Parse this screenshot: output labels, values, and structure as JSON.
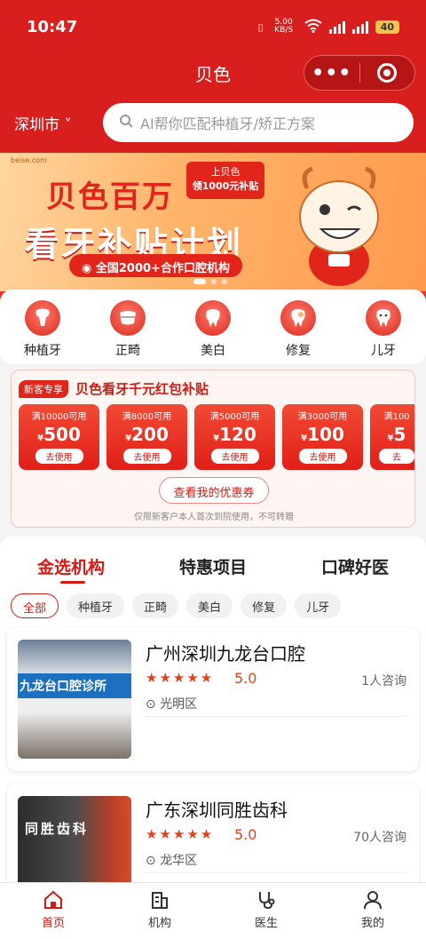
{
  "status": {
    "time": "10:47",
    "speed": "5.00 KB/S",
    "battery": "40"
  },
  "app": {
    "title": "贝色",
    "capsule_more": "•••"
  },
  "search": {
    "city": "深圳市 ˅",
    "placeholder": "AI帮你匹配种植牙/矫正方案"
  },
  "banner": {
    "site": "beise.com",
    "headline": "贝色百万",
    "subheadline": "看牙补贴计划",
    "tag_line1": "上贝色",
    "tag_line2": "领1000元补贴",
    "pill": "全国2000+合作口腔机构"
  },
  "categories": [
    {
      "label": "种植牙",
      "icon": "implant-tooth-icon"
    },
    {
      "label": "正畸",
      "icon": "braces-tooth-icon"
    },
    {
      "label": "美白",
      "icon": "whitening-tooth-icon"
    },
    {
      "label": "修复",
      "icon": "repair-tooth-icon"
    },
    {
      "label": "儿牙",
      "icon": "kids-tooth-icon"
    }
  ],
  "coupon_panel": {
    "tag": "新客专享",
    "title": "贝色看牙千元红包补贴",
    "coupons": [
      {
        "condition": "满10000可用",
        "amount": "500",
        "action": "去使用"
      },
      {
        "condition": "满8000可用",
        "amount": "200",
        "action": "去使用"
      },
      {
        "condition": "满5000可用",
        "amount": "120",
        "action": "去使用"
      },
      {
        "condition": "满3000可用",
        "amount": "100",
        "action": "去使用"
      },
      {
        "condition": "满100",
        "amount": "5",
        "action": "去"
      }
    ],
    "currency": "¥",
    "view_button": "查看我的优惠券",
    "note": "仅限新客户本人首次到院使用，不可转赠"
  },
  "tabs": [
    "金选机构",
    "特惠项目",
    "口碑好医"
  ],
  "chips": [
    "全部",
    "种植牙",
    "正畸",
    "美白",
    "修复",
    "儿牙"
  ],
  "clinics": [
    {
      "name": "广州深圳九龙台口腔",
      "stars": "★★★★★",
      "score": "5.0",
      "consult": "1人咨询",
      "area": "光明区",
      "sign": "九龙台口腔诊所"
    },
    {
      "name": "广东深圳同胜齿科",
      "stars": "★★★★★",
      "score": "5.0",
      "consult": "70人咨询",
      "area": "龙华区",
      "sign": "同胜齿科"
    }
  ],
  "nav": [
    "首页",
    "机构",
    "医生",
    "我的"
  ],
  "colors": {
    "brand_red": "#d91e1e",
    "accent_red": "#e1251b"
  }
}
